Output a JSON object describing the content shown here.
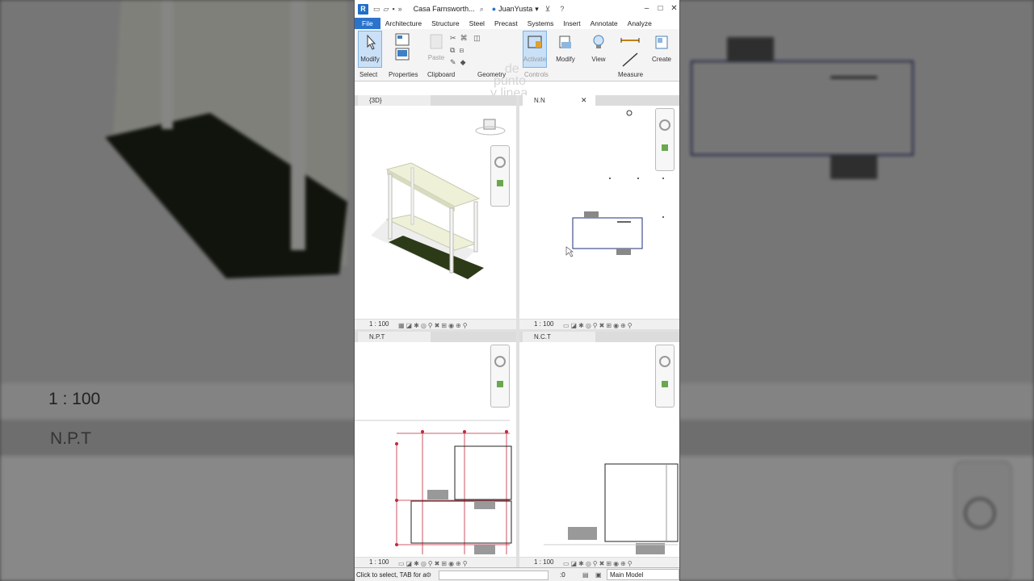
{
  "window": {
    "title": "Casa Farnsworth...",
    "user": "JuanYusta"
  },
  "ribbon_tabs": [
    "File",
    "Architecture",
    "Structure",
    "Steel",
    "Precast",
    "Systems",
    "Insert",
    "Annotate",
    "Analyze"
  ],
  "ribbon": {
    "modify": "Modify",
    "select": "Select",
    "properties": "Properties",
    "paste": "Paste",
    "clipboard": "Clipboard",
    "geometry": "Geometry",
    "activate": "Activate",
    "controls": "Controls",
    "modify2": "Modify",
    "view": "View",
    "measure": "Measure",
    "create": "Create"
  },
  "overlay_text": [
    "de",
    "punto",
    "y linea"
  ],
  "views": {
    "v3d": {
      "title": "{3D}",
      "scale": "1 : 100"
    },
    "top_right": {
      "title": "N.N",
      "scale": "1 : 100"
    },
    "npt": {
      "title": "N.P.T",
      "scale": "1 : 100"
    },
    "nct": {
      "title": "N.C.T",
      "scale": "1 : 100"
    }
  },
  "background": {
    "scale": "1 : 100",
    "view_title": "N.P.T"
  },
  "status": {
    "message": "Click to select, TAB for a",
    "count": ":0",
    "model": "Main Model"
  },
  "colors": {
    "accent": "#2a73cc",
    "selection": "#c9e0f7",
    "grid_red": "#c0283c",
    "plan_blue": "#1e2f7a"
  }
}
